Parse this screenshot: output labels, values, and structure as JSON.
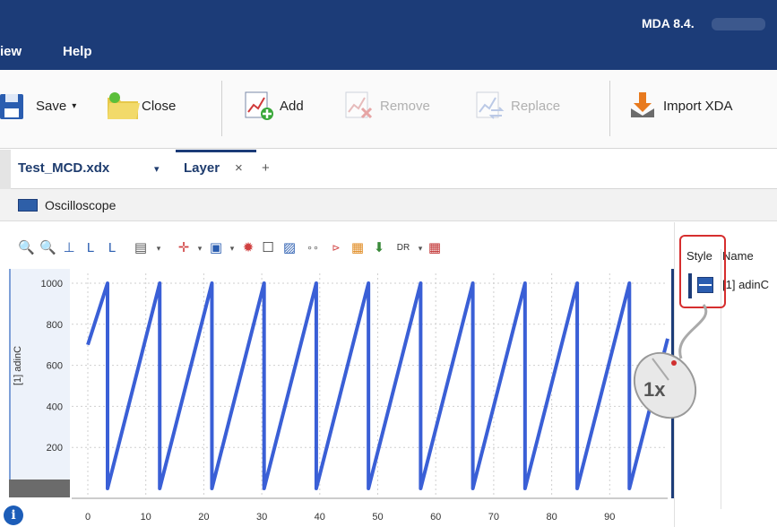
{
  "app": {
    "title": "MDA 8.4."
  },
  "menu": {
    "items": [
      "iew",
      "Help"
    ]
  },
  "ribbon": {
    "save_label": "Save",
    "close_label": "Close",
    "add_label": "Add",
    "remove_label": "Remove",
    "replace_label": "Replace",
    "import_label": "Import XDA"
  },
  "tabs": {
    "file_tab": "Test_MCD.xdx",
    "layer_tab": "Layer",
    "close_glyph": "×",
    "add_glyph": "+",
    "dropdown_glyph": "▾"
  },
  "panel": {
    "title": "Oscilloscope"
  },
  "plot_toolbar": {
    "dr_label": "DR"
  },
  "chart_data": {
    "type": "line",
    "title": "",
    "xlabel": "",
    "ylabel": "[1] adinC",
    "xlim": [
      0,
      100
    ],
    "ylim": [
      0,
      1000
    ],
    "x_ticks": [
      0,
      10,
      20,
      30,
      40,
      50,
      60,
      70,
      80,
      90
    ],
    "y_ticks": [
      200,
      400,
      600,
      800,
      1000
    ],
    "grid": true,
    "series": [
      {
        "name": "",
        "color": "#3a5fd6",
        "x": [
          0,
          3.4,
          3.4,
          12.4,
          12.4,
          21.4,
          21.4,
          30.4,
          30.4,
          39.4,
          39.4,
          48.4,
          48.4,
          57.4,
          57.4,
          66.4,
          66.4,
          75.4,
          75.4,
          84.4,
          84.4,
          93.4,
          93.4,
          100
        ],
        "y": [
          700,
          1000,
          0,
          1000,
          0,
          1000,
          0,
          1000,
          0,
          1000,
          0,
          1000,
          0,
          1000,
          0,
          1000,
          0,
          1000,
          0,
          1000,
          0,
          1000,
          0,
          730
        ]
      }
    ]
  },
  "channels": {
    "style_header": "Style",
    "name_header": "Name",
    "rows": [
      {
        "name": "[1] adinC"
      }
    ]
  },
  "mouse_hint": {
    "label": "1x"
  },
  "info_icon": {
    "glyph": "i"
  }
}
